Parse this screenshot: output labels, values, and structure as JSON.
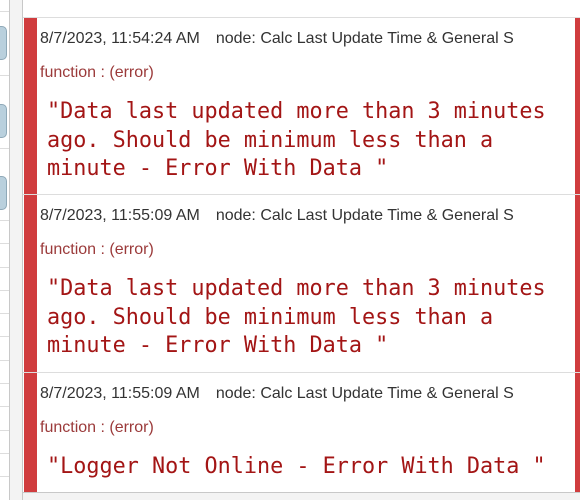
{
  "colors": {
    "error_bar": "#d03c3e",
    "payload_text": "#a31515",
    "topic_text": "#9b3a3a",
    "meta_text": "#333333"
  },
  "previous_message_tail": "···········",
  "messages": [
    {
      "timestamp": "8/7/2023, 11:54:24 AM",
      "node": "node: Calc Last Update Time & General S",
      "topic": "function : (error)",
      "payload": "\"Data last updated more than 3 minutes ago. Should be minimum less than a minute - Error With Data \""
    },
    {
      "timestamp": "8/7/2023, 11:55:09 AM",
      "node": "node: Calc Last Update Time & General S",
      "topic": "function : (error)",
      "payload": "\"Data last updated more than 3 minutes ago. Should be minimum less than a minute - Error With Data \""
    },
    {
      "timestamp": "8/7/2023, 11:55:09 AM",
      "node": "node: Calc Last Update Time & General S",
      "topic": "function : (error)",
      "payload": "\"Logger Not Online - Error With Data \""
    }
  ]
}
